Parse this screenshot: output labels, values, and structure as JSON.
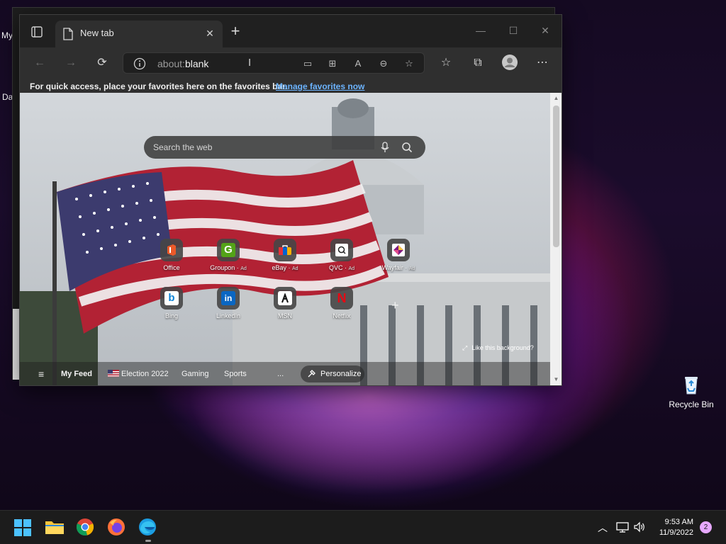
{
  "desktop": {
    "peek_labels": [
      "My",
      "Da"
    ],
    "recycle_bin_label": "Recycle Bin"
  },
  "browser": {
    "tab": {
      "title": "New tab"
    },
    "address": {
      "scheme": "about:",
      "rest": "blank"
    },
    "favorites_bar": {
      "message": "For quick access, place your favorites here on the favorites bar.",
      "link": "Manage favorites now"
    },
    "newtab": {
      "search_placeholder": "Search the web",
      "tiles": [
        {
          "label": "Office",
          "ad": ""
        },
        {
          "label": "Groupon",
          "ad": "Ad"
        },
        {
          "label": "eBay",
          "ad": "Ad"
        },
        {
          "label": "QVC",
          "ad": "Ad"
        },
        {
          "label": "Wayfair",
          "ad": "Ad"
        },
        {
          "label": "Bing",
          "ad": ""
        },
        {
          "label": "LinkedIn",
          "ad": ""
        },
        {
          "label": "MSN",
          "ad": ""
        },
        {
          "label": "Netflix",
          "ad": ""
        }
      ],
      "like_background": "Like this background?",
      "feed": {
        "items": [
          "My Feed",
          "Election 2022",
          "Gaming",
          "Sports",
          "..."
        ],
        "personalize": "Personalize"
      }
    }
  },
  "taskbar": {
    "time": "9:53 AM",
    "date": "11/9/2022",
    "notification_count": "2"
  },
  "colors": {
    "accent_link": "#6cb4ff",
    "notif_badge": "#e6a8ff"
  }
}
